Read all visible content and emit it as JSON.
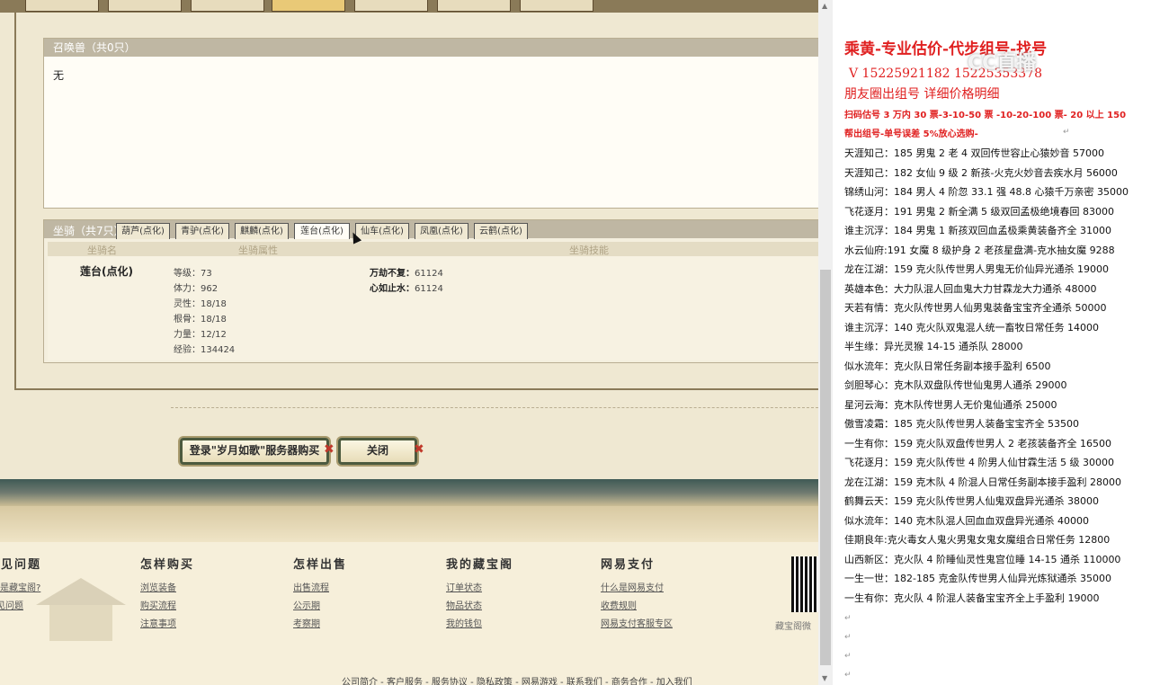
{
  "summon": {
    "title": "召唤兽（共0只）",
    "empty_text": "无"
  },
  "mount": {
    "title": "坐骑（共7只）",
    "tabs": [
      "葫芦(点化)",
      "青驴(点化)",
      "麒麟(点化)",
      "莲台(点化)",
      "仙车(点化)",
      "凤凰(点化)",
      "云鹤(点化)"
    ],
    "col_name": "坐骑名",
    "col_attr": "坐骑属性",
    "col_skill": "坐骑技能",
    "name": "莲台(点化)",
    "attrs": [
      "等级：73",
      "体力：962",
      "灵性：18/18",
      "根骨：18/18",
      "力量：12/12",
      "经验：134424"
    ],
    "skill1_label": "万劫不复：",
    "skill1_val": "61124",
    "skill2_label": "心如止水：",
    "skill2_val": "61124"
  },
  "buttons": {
    "buy": "登录\"岁月如歌\"服务器购买",
    "close": "关闭",
    "x": "✖"
  },
  "footer": {
    "cols": [
      {
        "title": "常见问题",
        "links": [
          "么是藏宝阁?",
          "见问题"
        ]
      },
      {
        "title": "怎样购买",
        "links": [
          "浏览装备",
          "购买流程",
          "注意事项"
        ]
      },
      {
        "title": "怎样出售",
        "links": [
          "出售流程",
          "公示期",
          "考察期"
        ]
      },
      {
        "title": "我的藏宝阁",
        "links": [
          "订单状态",
          "物品状态",
          "我的钱包"
        ]
      },
      {
        "title": "网易支付",
        "links": [
          "什么是网易支付",
          "收费规则",
          "网易支付客服专区"
        ]
      }
    ],
    "qr_label": "藏宝阁微",
    "bottom_links": "公司简介 - 客户服务 - 服务协议 - 隐私政策 - 网易游戏 - 联系我们 - 商务合作 - 加入我们"
  },
  "doc": {
    "header1": "乘黄-专业估价-代步组号-找号",
    "header2": "V 15225921182   15225353378",
    "header3": "朋友圈出组号    详细价格明细",
    "red1": "扫码估号 3 万内 30 票-3-10-50 票  -10-20-100 票- 20 以上 150",
    "red2": "帮出组号-单号误差 5%放心选购-",
    "logo": "CC直播",
    "lines": [
      "天涯知己：185 男鬼 2 老 4 双回传世容止心猿妙音 57000",
      "天涯知己：182 女仙 9 级 2 新孩-火克火妙音去疾水月 56000",
      "锦绣山河：184 男人 4 阶忽 33.1 强 48.8 心猿千万亲密 35000",
      "飞花逐月：191 男鬼 2 新全满 5 级双回孟极绝境春回 83000",
      "谁主沉浮：184 男鬼 1 新孩双回血孟极乘黄装备齐全 31000",
      "水云仙府:191 女魔 8 级护身 2 老孩星盘满-克水抽女魔 9288",
      "龙在江湖：159 克火队传世男人男鬼无价仙异光通杀 19000",
      "英雄本色：大力队混人回血鬼大力甘霖龙大力通杀 48000",
      "天若有情：克火队传世男人仙男鬼装备宝宝齐全通杀 50000",
      "谁主沉浮：140 克火队双鬼混人统一畜牧日常任务 14000",
      "半生缘：异光灵猴 14-15 通杀队 28000",
      "似水流年：克火队日常任务副本接手盈利 6500",
      "剑胆琴心：克木队双盘队传世仙鬼男人通杀 29000",
      "星河云海：克木队传世男人无价鬼仙通杀 25000",
      "傲雪凌霜：185 克火队传世男人装备宝宝齐全 53500",
      "一生有你：159 克火队双盘传世男人 2 老孩装备齐全 16500",
      "飞花逐月：159 克火队传世 4 阶男人仙甘霖生活 5 级 30000",
      "龙在江湖：159 克木队 4 阶混人日常任务副本接手盈利 28000",
      "鹤舞云天：159 克火队传世男人仙鬼双盘异光通杀 38000",
      "似水流年：140 克木队混人回血血双盘异光通杀 40000",
      "佳期良年:克火毒女人鬼火男鬼女鬼女魔组合日常任务 12800",
      "山西新区：克火队 4 阶睡仙灵性鬼宫位睡 14-15 通杀 110000",
      "一生一世：182-185 克金队传世男人仙异光炼狱通杀 35000",
      "一生有你：克火队 4 阶混人装备宝宝齐全上手盈利 19000"
    ],
    "para_mark": "↵"
  }
}
